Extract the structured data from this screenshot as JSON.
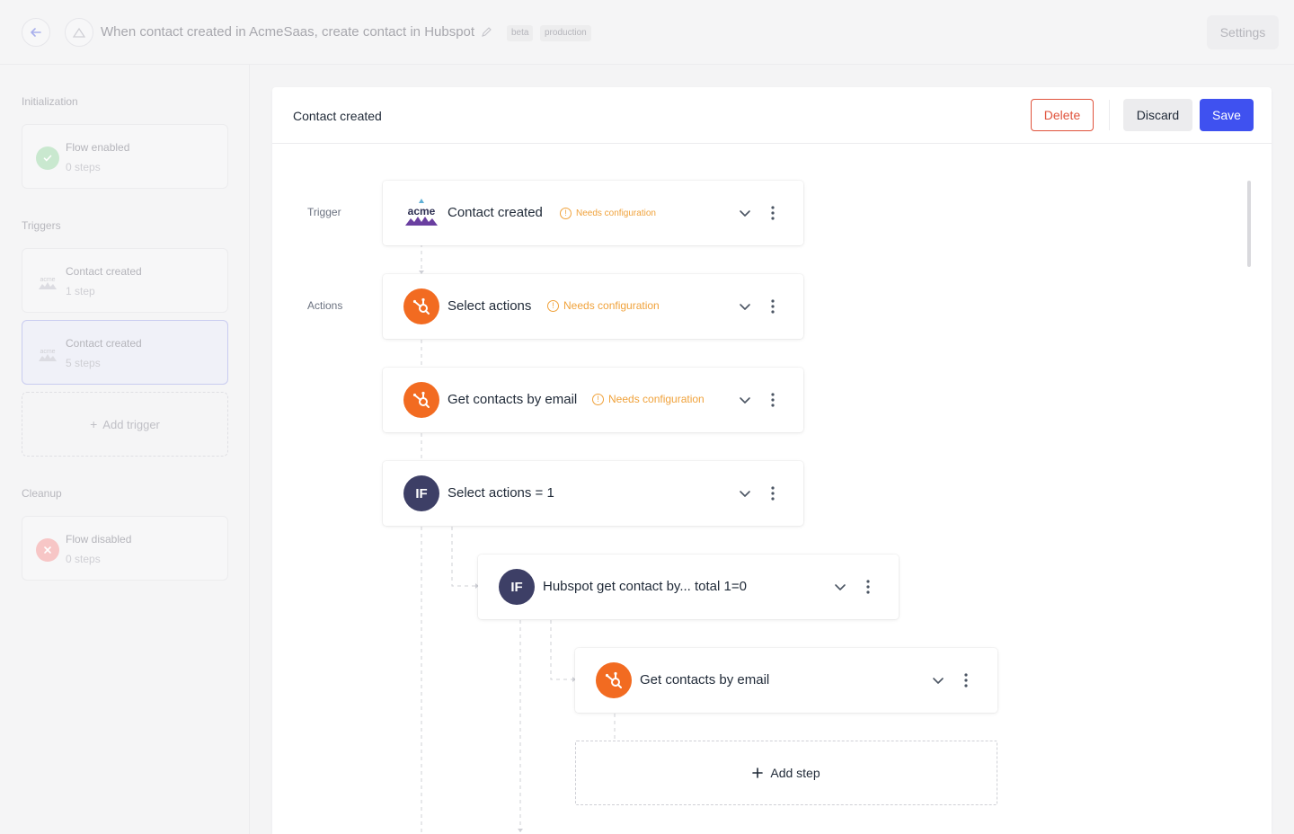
{
  "header": {
    "title": "When contact created in AcmeSaas, create contact in Hubspot",
    "tags": [
      "beta",
      "production"
    ],
    "settings_label": "Settings"
  },
  "sidebar": {
    "sections": [
      {
        "label": "Initialization"
      },
      {
        "label": "Triggers"
      },
      {
        "label": "Cleanup"
      }
    ],
    "items": [
      {
        "title": "Flow enabled",
        "subtitle": "0 steps",
        "icon": "check-icon"
      },
      {
        "title": "Contact created",
        "subtitle": "1 step",
        "icon": "acme-logo-icon"
      },
      {
        "title": "Contact created",
        "subtitle": "5 steps",
        "icon": "acme-logo-icon",
        "selected": true
      },
      {
        "title": "Flow disabled",
        "subtitle": "0 steps",
        "icon": "x-icon"
      }
    ],
    "add_trigger_label": "Add trigger"
  },
  "panel": {
    "title": "Contact created",
    "delete_label": "Delete",
    "discard_label": "Discard",
    "save_label": "Save",
    "trigger_label": "Trigger",
    "actions_label": "Actions"
  },
  "steps": [
    {
      "title": "Contact created",
      "warning": "Needs configuration",
      "icon": "acme-logo-icon",
      "logo_text": "acme"
    },
    {
      "title": "Select actions",
      "warning": "Needs configuration",
      "icon": "hubspot-icon"
    },
    {
      "title": "Get contacts by email",
      "warning": "Needs configuration",
      "icon": "hubspot-icon"
    },
    {
      "title": "Select actions = 1",
      "icon": "if-icon",
      "icon_text": "IF"
    },
    {
      "title": "Hubspot get contact by... total 1=0",
      "icon": "if-icon",
      "icon_text": "IF"
    },
    {
      "title": "Get contacts by email",
      "icon": "hubspot-icon"
    }
  ],
  "add_step_label": "Add step",
  "colors": {
    "accent": "#3f51f0",
    "danger": "#e0533c",
    "warning": "#f0a23b",
    "hubspot": "#f26b21",
    "if_badge": "#3d3f66"
  }
}
